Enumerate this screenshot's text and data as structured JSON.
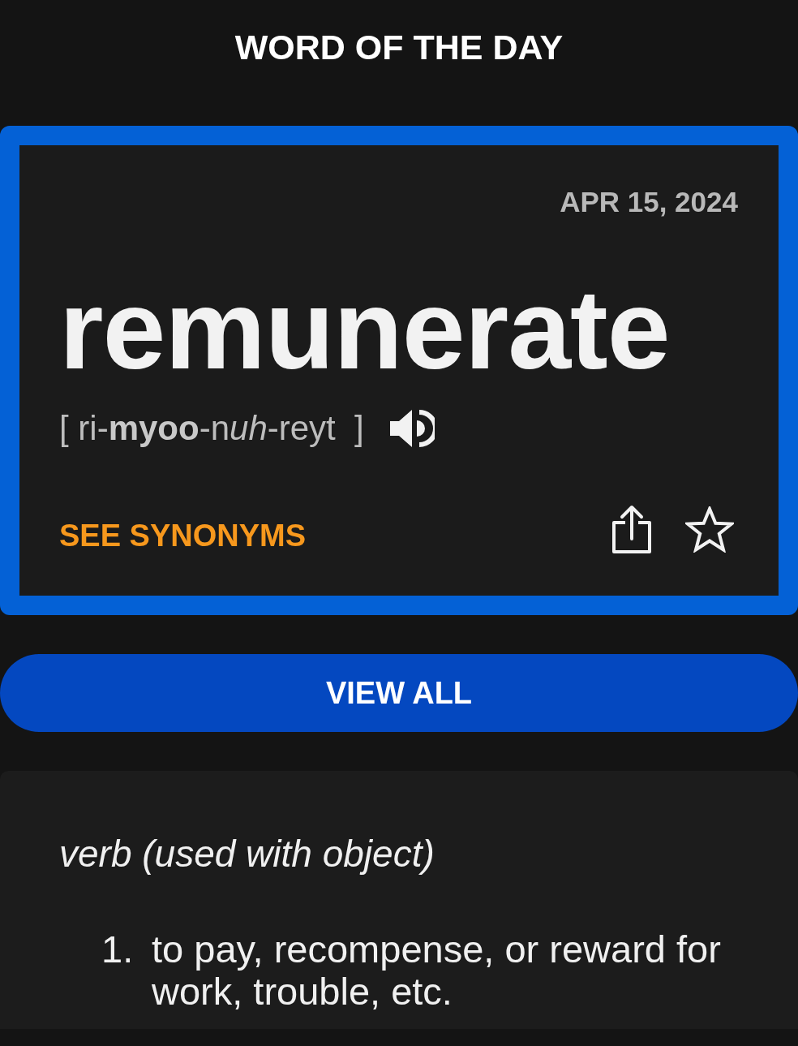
{
  "header": {
    "title": "WORD OF THE DAY"
  },
  "word_card": {
    "date": "APR 15, 2024",
    "word": "remunerate",
    "pronunciation": [
      {
        "kind": "plain",
        "text": "[ ri-"
      },
      {
        "kind": "bold",
        "text": "myoo"
      },
      {
        "kind": "plain",
        "text": "-n"
      },
      {
        "kind": "italic",
        "text": "uh"
      },
      {
        "kind": "plain",
        "text": "-reyt  ]"
      }
    ],
    "see_synonyms": "SEE SYNONYMS",
    "starred": false
  },
  "view_all_button": "VIEW ALL",
  "definition": {
    "part_of_speech": "verb (used with object)",
    "senses": [
      {
        "number": "1.",
        "text": "to pay, recompense, or reward for work, trouble, etc."
      }
    ]
  }
}
